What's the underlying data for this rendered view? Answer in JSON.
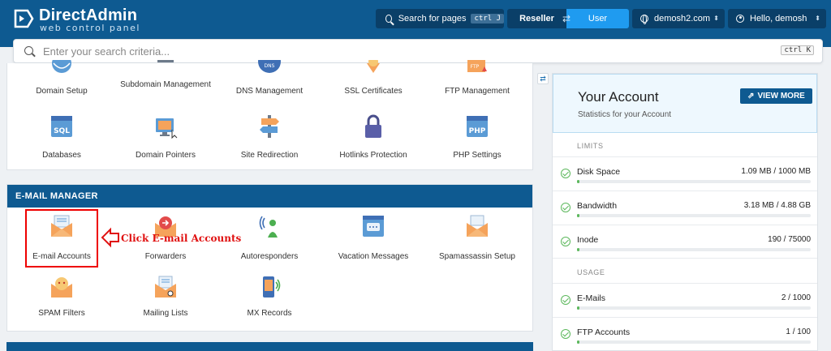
{
  "header": {
    "logo_name": "DirectAdmin",
    "logo_tagline": "web control panel",
    "search_pages_label": "Search for pages",
    "search_pages_shortcut": "ctrl J",
    "role_reseller": "Reseller",
    "role_user": "User",
    "domain": "demosh2.com",
    "greeting": "Hello, demosh"
  },
  "search": {
    "placeholder": "Enter your search criteria...",
    "shortcut": "ctrl K"
  },
  "top_section": {
    "tiles": [
      {
        "label": "Domain Setup",
        "icon": "globe-domain-icon"
      },
      {
        "label": "Subdomain Management",
        "icon": "subdomain-icon"
      },
      {
        "label": "DNS Management",
        "icon": "dns-globe-icon"
      },
      {
        "label": "SSL Certificates",
        "icon": "ssl-badge-icon"
      },
      {
        "label": "FTP Management",
        "icon": "ftp-folder-icon"
      },
      {
        "label": "Databases",
        "icon": "sql-database-icon"
      },
      {
        "label": "Domain Pointers",
        "icon": "domain-pointer-icon"
      },
      {
        "label": "Site Redirection",
        "icon": "signpost-icon"
      },
      {
        "label": "Hotlinks Protection",
        "icon": "padlock-icon"
      },
      {
        "label": "PHP Settings",
        "icon": "php-file-icon"
      }
    ]
  },
  "email_section": {
    "title": "E-MAIL MANAGER",
    "tiles": [
      {
        "label": "E-mail Accounts",
        "icon": "email-accounts-icon"
      },
      {
        "label": "Forwarders",
        "icon": "forwarder-icon"
      },
      {
        "label": "Autoresponders",
        "icon": "autoresponder-icon"
      },
      {
        "label": "Vacation Messages",
        "icon": "vacation-message-icon"
      },
      {
        "label": "Spamassassin Setup",
        "icon": "spamassassin-icon"
      },
      {
        "label": "SPAM Filters",
        "icon": "spam-filter-icon"
      },
      {
        "label": "Mailing Lists",
        "icon": "mailing-list-icon"
      },
      {
        "label": "MX Records",
        "icon": "mx-records-icon"
      }
    ]
  },
  "annotation": {
    "note": "Click E-mail Accounts",
    "color": "#e01010"
  },
  "account": {
    "title": "Your Account",
    "subtitle": "Statistics for your Account",
    "view_more": "VIEW MORE",
    "limits_label": "LIMITS",
    "usage_label": "USAGE",
    "limits": [
      {
        "name": "Disk Space",
        "value": "1.09 MB / 1000 MB",
        "fraction": 0.0011
      },
      {
        "name": "Bandwidth",
        "value": "3.18 MB / 4.88 GB",
        "fraction": 0.0006
      },
      {
        "name": "Inode",
        "value": "190 / 75000",
        "fraction": 0.0025
      }
    ],
    "usage": [
      {
        "name": "E-Mails",
        "value": "2 / 1000",
        "fraction": 0.002
      },
      {
        "name": "FTP Accounts",
        "value": "1 / 100",
        "fraction": 0.01
      }
    ]
  },
  "colors": {
    "brand": "#0e5a91",
    "accent": "#1f9bf0",
    "ok": "#5cb85c",
    "icon_orange": "#f5a35b"
  }
}
